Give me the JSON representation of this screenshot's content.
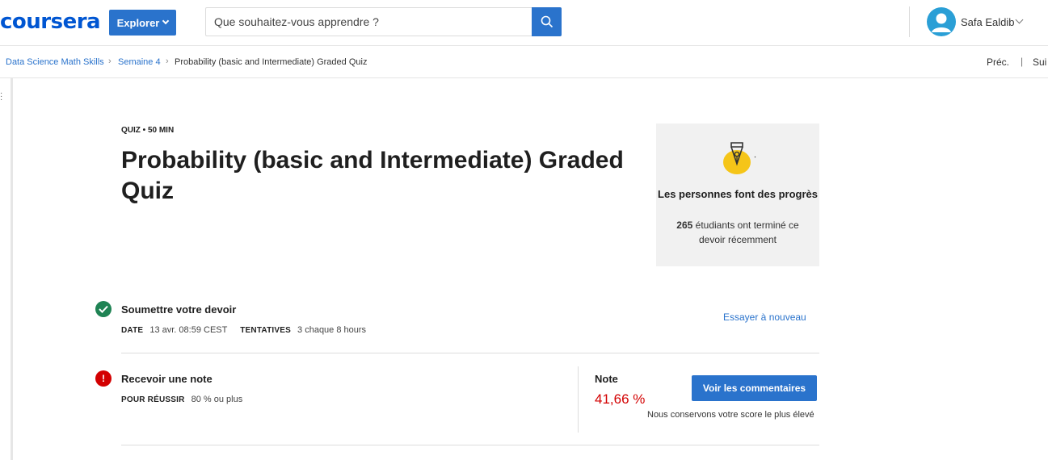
{
  "header": {
    "logo": "coursera",
    "explore_label": "Explorer",
    "search_placeholder": "Que souhaitez-vous apprendre ?",
    "user_name": "Safa Ealdib"
  },
  "breadcrumb": {
    "items": [
      "Data Science Math Skills",
      "Semaine 4",
      "Probability (basic and Intermediate) Graded Quiz"
    ],
    "prev_label": "Préc.",
    "next_label": "Sui"
  },
  "quiz": {
    "meta": "QUIZ • 50  MIN",
    "title": "Probability (basic and Intermediate) Graded Quiz"
  },
  "progress_card": {
    "title": "Les personnes font des progrès",
    "count": "265",
    "text": "étudiants ont terminé ce devoir récemment"
  },
  "submit_step": {
    "title": "Soumettre votre devoir",
    "date_label": "DATE",
    "date_value": "13 avr. 08:59 CEST",
    "attempts_label": "TENTATIVES",
    "attempts_value": "3 chaque 8  hours",
    "retry_label": "Essayer à nouveau"
  },
  "grade_step": {
    "title": "Recevoir une note",
    "pass_label": "POUR RÉUSSIR",
    "pass_value": "80 % ou plus",
    "grade_label": "Note",
    "grade_value": "41,66 %",
    "feedback_button": "Voir les commentaires",
    "keep_score_text": "Nous conservons votre score le plus élevé"
  },
  "colors": {
    "brand": "#0056d2",
    "button": "#2a73cc",
    "success": "#1f8354",
    "error": "#d30001"
  }
}
